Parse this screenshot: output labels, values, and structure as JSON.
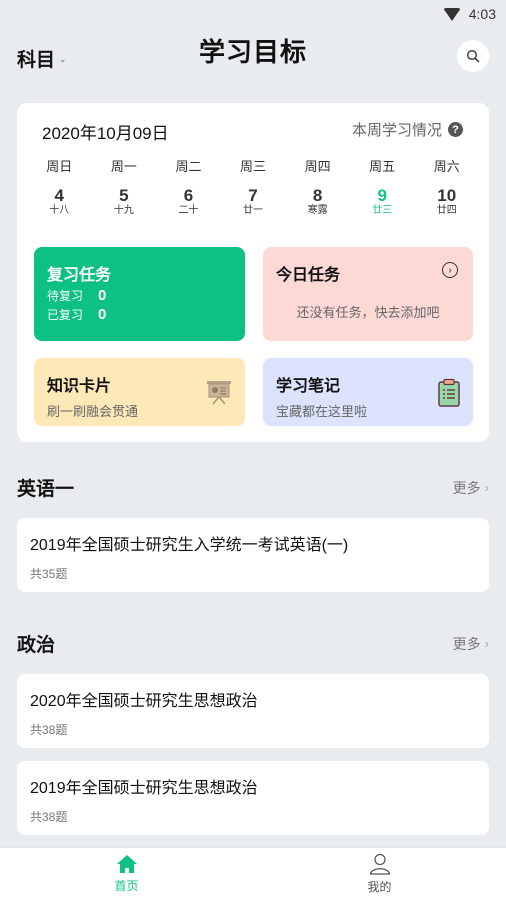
{
  "status_bar": {
    "time": "4:03"
  },
  "header": {
    "subject_label": "科目",
    "subject_chevron": "⌄",
    "title": "学习目标"
  },
  "calendar": {
    "date": "2020年10月09日",
    "week_info_label": "本周学习情况",
    "help_glyph": "?",
    "weekdays": [
      "周日",
      "周一",
      "周二",
      "周三",
      "周四",
      "周五",
      "周六"
    ],
    "days": [
      {
        "num": "4",
        "lunar": "十八",
        "active": false
      },
      {
        "num": "5",
        "lunar": "十九",
        "active": false
      },
      {
        "num": "6",
        "lunar": "二十",
        "active": false
      },
      {
        "num": "7",
        "lunar": "廿一",
        "active": false
      },
      {
        "num": "8",
        "lunar": "寒露",
        "active": false
      },
      {
        "num": "9",
        "lunar": "廿三",
        "active": true
      },
      {
        "num": "10",
        "lunar": "廿四",
        "active": false
      }
    ],
    "accent_color": "#10c283"
  },
  "tiles": {
    "review": {
      "title": "复习任务",
      "pending_label": "待复习",
      "pending_value": "0",
      "done_label": "已复习",
      "done_value": "0"
    },
    "today": {
      "title": "今日任务",
      "empty_text": "还没有任务，快去添加吧",
      "arrow_glyph": "›"
    },
    "cards": {
      "title": "知识卡片",
      "subtitle": "刷一刷融会贯通"
    },
    "notes": {
      "title": "学习笔记",
      "subtitle": "宝藏都在这里啦"
    }
  },
  "sections": [
    {
      "title": "英语一",
      "more_label": "更多",
      "items": [
        {
          "title": "2019年全国硕士研究生入学统一考试英语(一)",
          "count": "共35题"
        }
      ]
    },
    {
      "title": "政治",
      "more_label": "更多",
      "items": [
        {
          "title": "2020年全国硕士研究生思想政治",
          "count": "共38题"
        },
        {
          "title": "2019年全国硕士研究生思想政治",
          "count": "共38题"
        }
      ]
    }
  ],
  "tabbar": {
    "tabs": [
      {
        "label": "首页",
        "icon": "home-icon",
        "active": true
      },
      {
        "label": "我的",
        "icon": "user-icon",
        "active": false
      }
    ]
  }
}
